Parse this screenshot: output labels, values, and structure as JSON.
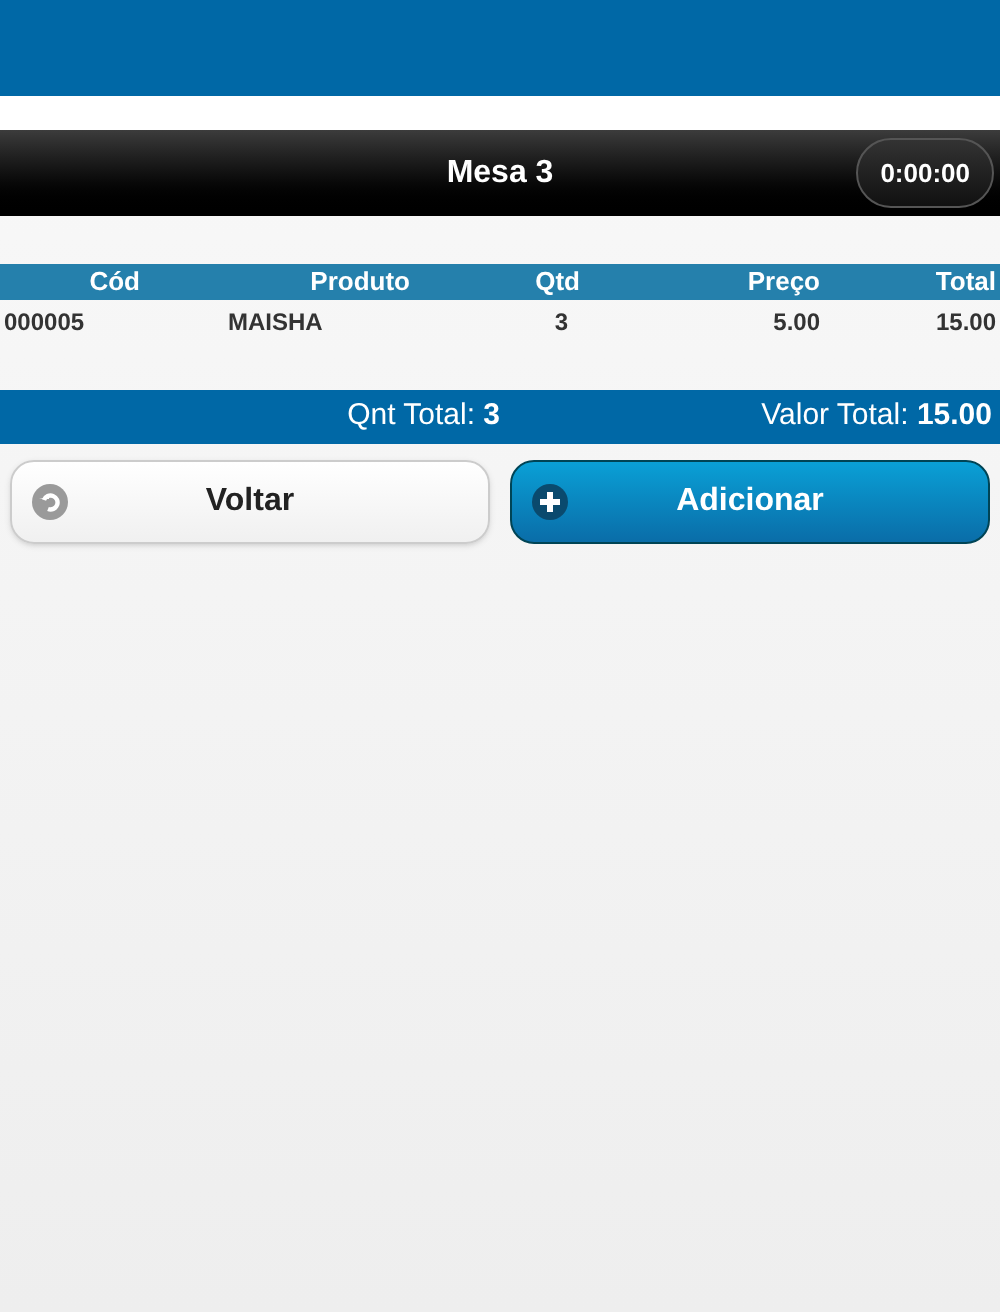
{
  "header": {
    "title": "Mesa 3",
    "timer": "0:00:00"
  },
  "table": {
    "columns": [
      "Cód",
      "Produto",
      "Qtd",
      "Preço",
      "Total"
    ],
    "rows": [
      [
        "000005",
        "MAISHA",
        "3",
        "5.00",
        "15.00"
      ]
    ]
  },
  "totals": {
    "quantity": "Qnt Total: **3**",
    "value": "Valor Total: **15.00**"
  },
  "buttons": [
    {
      "kind": "back",
      "label": "Voltar"
    },
    {
      "kind": "add",
      "label": "Adicionar"
    }
  ]
}
